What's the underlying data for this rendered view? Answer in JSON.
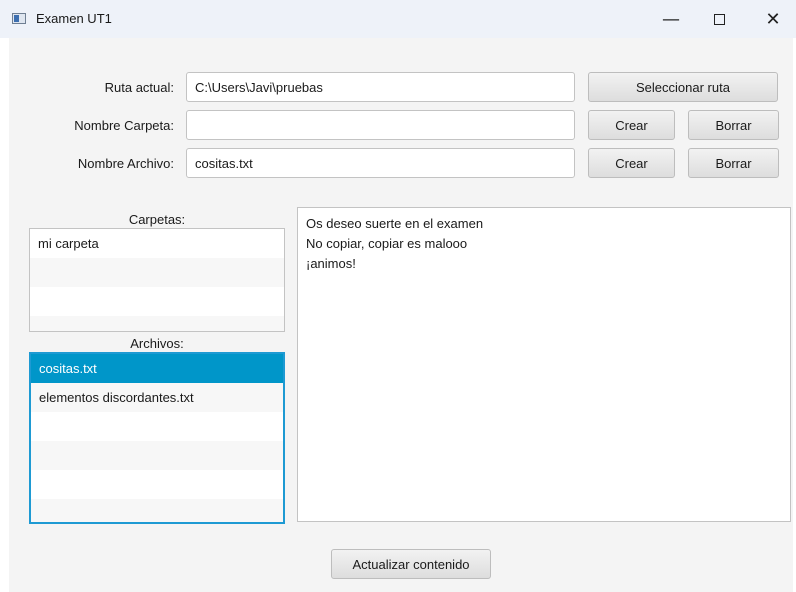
{
  "window": {
    "title": "Examen UT1",
    "minimize_glyph": "—",
    "close_glyph": "✕"
  },
  "form": {
    "ruta_label": "Ruta actual:",
    "ruta_value": "C:\\Users\\Javi\\pruebas",
    "seleccionar_label": "Seleccionar ruta",
    "carpeta_label": "Nombre Carpeta:",
    "carpeta_value": "",
    "carpeta_crear_label": "Crear",
    "carpeta_borrar_label": "Borrar",
    "archivo_label": "Nombre Archivo:",
    "archivo_value": "cositas.txt",
    "archivo_crear_label": "Crear",
    "archivo_borrar_label": "Borrar"
  },
  "carpetas": {
    "header": "Carpetas:",
    "items": [
      "mi carpeta"
    ]
  },
  "archivos": {
    "header": "Archivos:",
    "items": [
      "cositas.txt",
      "elementos discordantes.txt"
    ],
    "selected": "cositas.txt"
  },
  "content": {
    "lines": [
      "Os deseo suerte en el examen",
      "No copiar, copiar es malooo",
      "¡animos!"
    ]
  },
  "actualizar_label": "Actualizar contenido",
  "colors": {
    "selection": "#0096c9",
    "focus_border": "#1e9ad3",
    "window_background": "#f4f4f4",
    "titlebar": "#eef2f9"
  }
}
